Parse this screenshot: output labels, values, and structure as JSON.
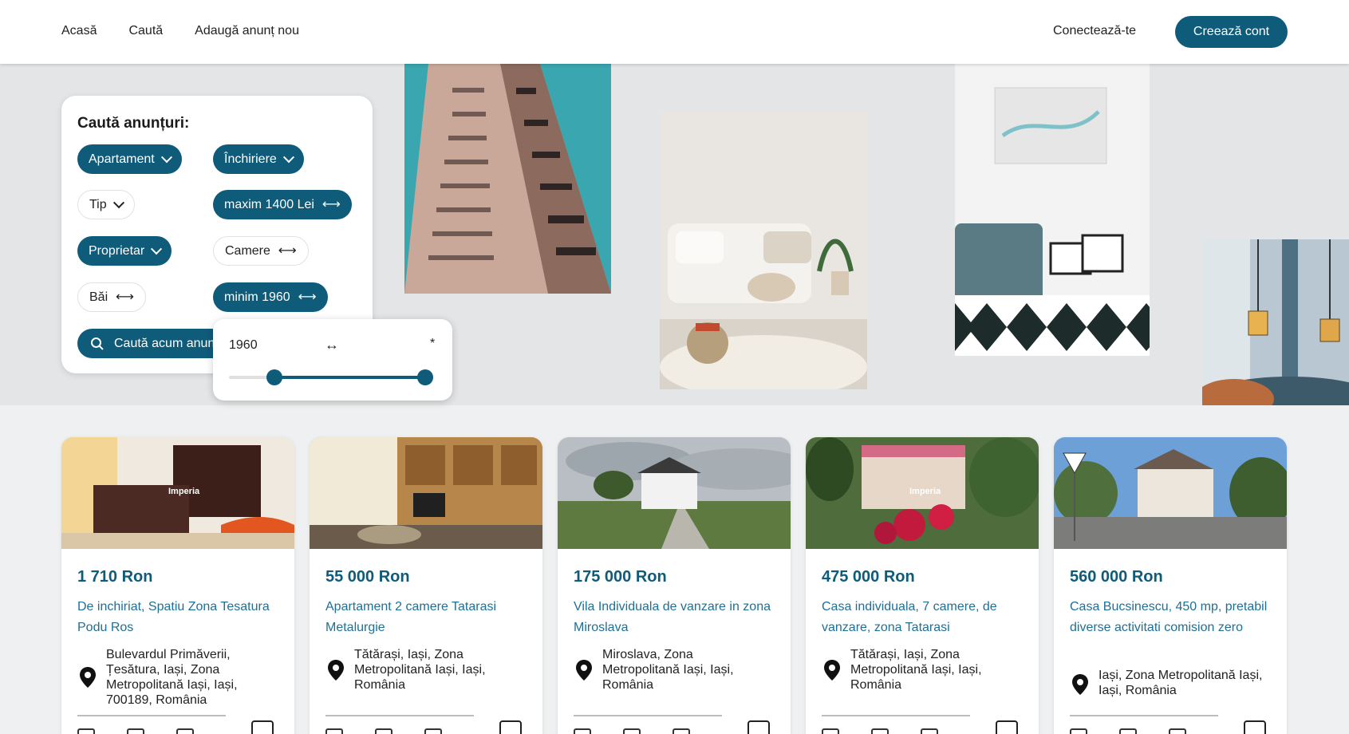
{
  "header": {
    "nav": [
      "Acasă",
      "Caută",
      "Adaugă anunț nou"
    ],
    "login_label": "Conectează-te",
    "signup_label": "Creează cont",
    "accent_color": "#0f5b7a"
  },
  "search": {
    "title": "Caută anunțuri:",
    "filters": {
      "property_type": "Apartament",
      "transaction": "Închiriere",
      "type": "Tip",
      "price": "maxim 1400 Lei",
      "owner": "Proprietar",
      "rooms": "Camere",
      "baths": "Băi",
      "year": "minim 1960"
    },
    "search_button": "Caută acum anunțuri",
    "year_range": {
      "min": "1960",
      "separator": "↔",
      "max": "*",
      "slider_low": 0.2,
      "slider_high": 1.0
    }
  },
  "listings": [
    {
      "price": "1 710 Ron",
      "title": "De inchiriat, Spatiu Zona Tesatura Podu Ros",
      "address": "Bulevardul Primăverii, Țesătura, Iași, Zona Metropolitană Iași, Iași, 700189, România"
    },
    {
      "price": "55 000 Ron",
      "title": "Apartament 2 camere Tatarasi Metalurgie",
      "address": "Tătărași, Iași, Zona Metropolitană Iași, Iași, România"
    },
    {
      "price": "175 000 Ron",
      "title": "Vila Individuala de vanzare in zona Miroslava",
      "address": "Miroslava, Zona Metropolitană Iași, Iași, România"
    },
    {
      "price": "475 000 Ron",
      "title": "Casa individuala, 7 camere, de vanzare, zona Tatarasi",
      "address": "Tătărași, Iași, Zona Metropolitană Iași, Iași, România"
    },
    {
      "price": "560 000 Ron",
      "title": "Casa Bucsinescu, 450 mp, pretabil diverse activitati comision zero",
      "address": "Iași, Zona Metropolitană Iași, Iași, România"
    }
  ],
  "watermarks": {
    "logo_text": "Imperia"
  }
}
